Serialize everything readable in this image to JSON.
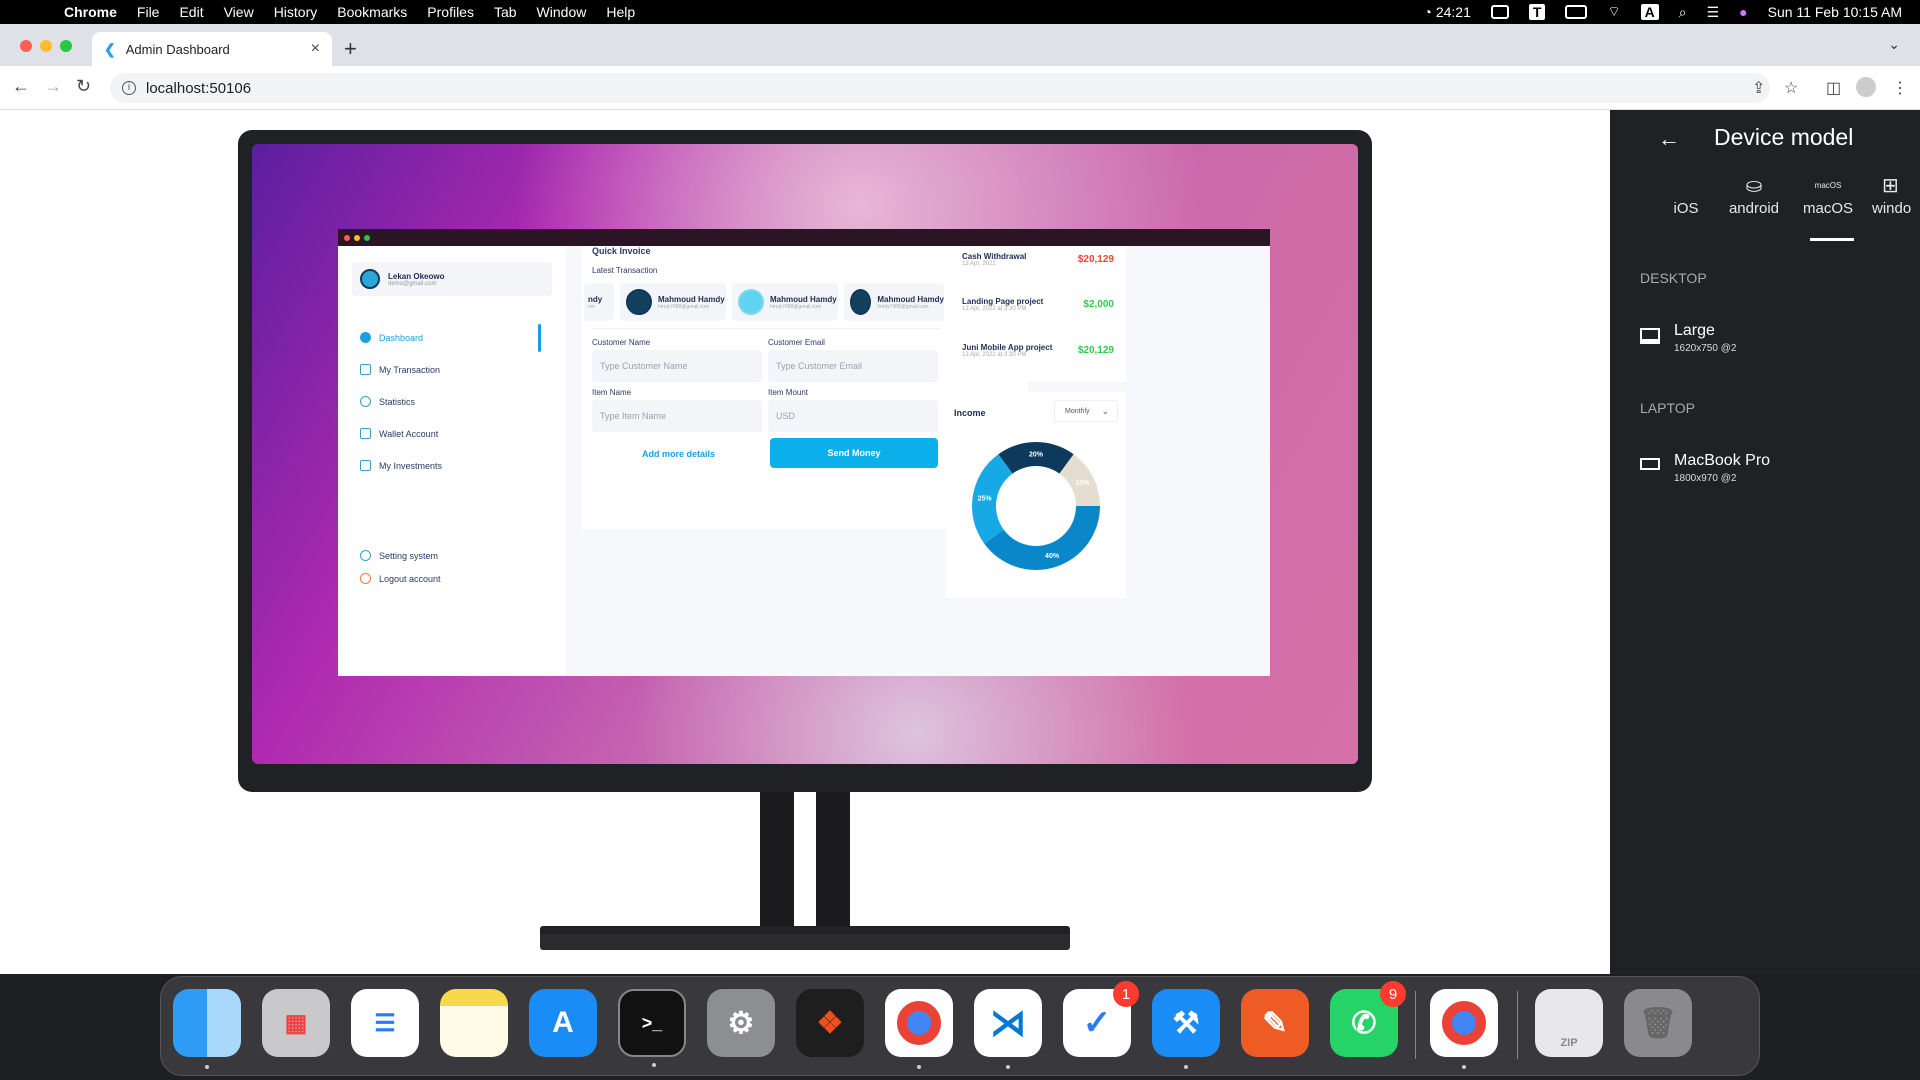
{
  "menubar": {
    "app": "Chrome",
    "items": [
      "File",
      "Edit",
      "View",
      "History",
      "Bookmarks",
      "Profiles",
      "Tab",
      "Window",
      "Help"
    ],
    "timer": "24:21",
    "input_source": "A",
    "datetime": "Sun 11 Feb  10:15 AM"
  },
  "browser": {
    "tab_title": "Admin Dashboard",
    "url": "localhost:50106"
  },
  "app": {
    "user": {
      "name": "Lekan Okeowo",
      "email": "demo@gmail.com"
    },
    "nav": [
      "Dashboard",
      "My Transaction",
      "Statistics",
      "Wallet Account",
      "My Investments"
    ],
    "nav_bottom": [
      "Setting system",
      "Logout account"
    ],
    "invoice": {
      "title": "Quick Invoice",
      "plus": "+",
      "latest_label": "Latest Transaction",
      "partial_card": {
        "name": "ndy",
        "email": "om"
      },
      "cards": [
        {
          "name": "Mahmoud Hamdy",
          "email": "hmdy7488@gmail.com"
        },
        {
          "name": "Mahmoud Hamdy",
          "email": "hmdy7488@gmail.com"
        },
        {
          "name": "Mahmoud Hamdy",
          "email": "hmdy7488@gmail.com"
        }
      ],
      "customer_name_label": "Customer Name",
      "customer_name_placeholder": "Type Customer Name",
      "customer_email_label": "Customer Email",
      "customer_email_placeholder": "Type Customer Email",
      "item_name_label": "Item Name",
      "item_name_placeholder": "Type Item Name",
      "item_amount_label": "Item Mount",
      "item_amount_placeholder": "USD",
      "add_more": "Add more details",
      "send": "Send Money"
    },
    "transactions": [
      {
        "title": "Cash Withdrawal",
        "date": "13 Apr, 2022",
        "amount": "$20,129",
        "color": "#f04438"
      },
      {
        "title": "Landing Page project",
        "date": "13 Apr, 2022 at 3:30 PM",
        "amount": "$2,000",
        "color": "#32c850"
      },
      {
        "title": "Juni Mobile App project",
        "date": "13 Apr, 2022 at 3:30 PM",
        "amount": "$20,129",
        "color": "#32c850"
      }
    ],
    "income": {
      "title": "Income",
      "period": "Monthly",
      "slices": [
        {
          "label": "20%",
          "value": 20,
          "color": "#0d3a5a"
        },
        {
          "label": "15%",
          "value": 15,
          "color": "#e5ddd0"
        },
        {
          "label": "40%",
          "value": 40,
          "color": "#0a87c8"
        },
        {
          "label": "25%",
          "value": 25,
          "color": "#17a9e6"
        }
      ]
    }
  },
  "device_panel": {
    "title": "Device model",
    "os_tabs": [
      {
        "label": "iOS",
        "icon": "apple-icon"
      },
      {
        "label": "android",
        "icon": "android-icon"
      },
      {
        "label": "macOS",
        "icon_text": "macOS"
      },
      {
        "label": "windo",
        "icon": "windows-icon"
      }
    ],
    "sections": [
      {
        "heading": "DESKTOP",
        "device": "Large",
        "size": "1620x750 @2"
      },
      {
        "heading": "LAPTOP",
        "device": "MacBook Pro",
        "size": "1800x970 @2"
      }
    ]
  },
  "dock": {
    "badges": {
      "tasks": "1",
      "whatsapp": "9"
    },
    "zip_label": "ZIP"
  }
}
